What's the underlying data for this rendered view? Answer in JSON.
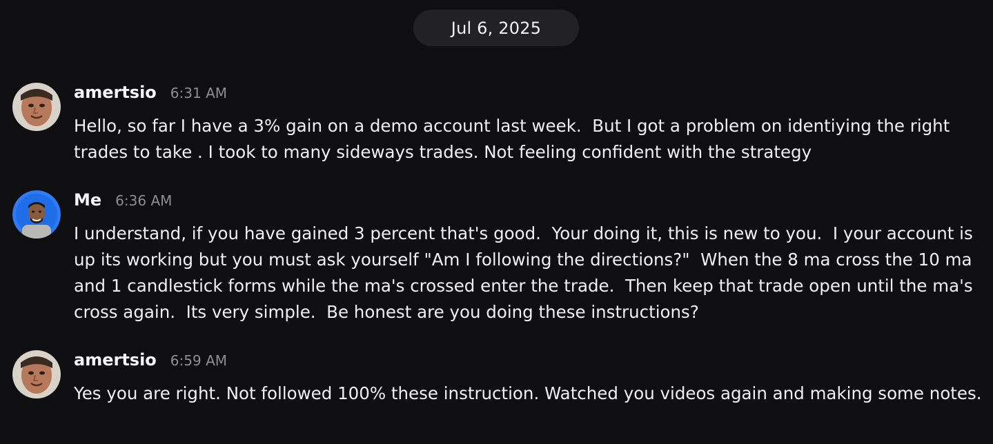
{
  "conversation": {
    "date_divider": "Jul 6, 2025",
    "messages": [
      {
        "author": "amertsio",
        "time": "6:31 AM",
        "avatar": "avatar-amertsio",
        "text": "Hello, so far I have a 3% gain on a demo account last week.  But I got a problem on identiying the right trades to take . I took to many sideways trades. Not feeling confident with the strategy"
      },
      {
        "author": "Me",
        "time": "6:36 AM",
        "avatar": "avatar-me",
        "text": "I understand, if you have gained 3 percent that's good.  Your doing it, this is new to you.  I your account is up its working but you must ask yourself \"Am I following the directions?\"  When the 8 ma cross the 10 ma and 1 candlestick forms while the ma's crossed enter the trade.  Then keep that trade open until the ma's cross again.  Its very simple.  Be honest are you doing these instructions?"
      },
      {
        "author": "amertsio",
        "time": "6:59 AM",
        "avatar": "avatar-amertsio",
        "text": "Yes you are right. Not followed 100% these instruction. Watched you videos again and making some notes."
      }
    ]
  },
  "colors": {
    "background": "#0f0f11",
    "pill": "#222226",
    "me_avatar_ring": "#2f7bf6",
    "timestamp": "#8d8d94"
  }
}
